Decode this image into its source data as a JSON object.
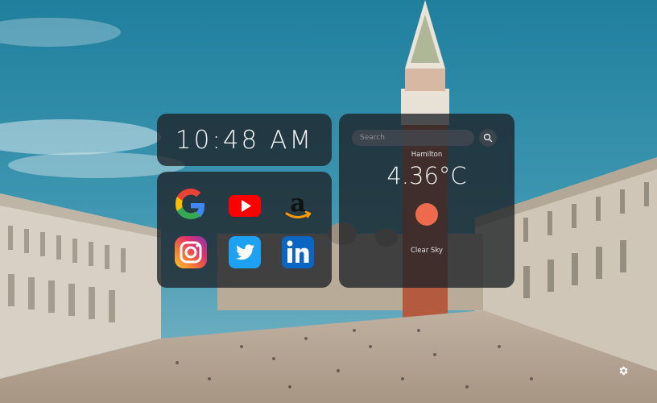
{
  "clock": {
    "time": "10:48 AM"
  },
  "links": [
    {
      "name": "Google",
      "icon": "google-icon"
    },
    {
      "name": "YouTube",
      "icon": "youtube-icon"
    },
    {
      "name": "Amazon",
      "icon": "amazon-icon"
    },
    {
      "name": "Instagram",
      "icon": "instagram-icon"
    },
    {
      "name": "Twitter",
      "icon": "twitter-icon"
    },
    {
      "name": "LinkedIn",
      "icon": "linkedin-icon"
    }
  ],
  "weather": {
    "search_placeholder": "Search",
    "city": "Hamilton",
    "temperature": "4.36°C",
    "condition": "Clear Sky",
    "sun_color": "#ee6a4c"
  },
  "settings": {
    "icon": "gear-icon"
  },
  "colors": {
    "card_bg": "rgba(30,33,38,0.78)",
    "sky": "#2f8aa8"
  }
}
